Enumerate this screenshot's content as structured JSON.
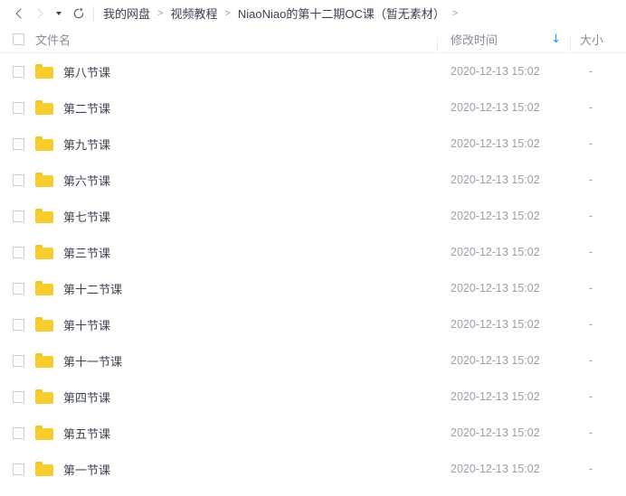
{
  "nav": {
    "back_icon": "chevron-left-icon",
    "forward_icon": "chevron-right-icon",
    "history_dropdown_icon": "caret-down-icon",
    "refresh_icon": "refresh-icon",
    "breadcrumb": {
      "items": [
        "我的网盘",
        "视频教程",
        "NiaoNiao的第十二期OC课（暂无素材）"
      ],
      "separator": ">",
      "trailing_separator": ">"
    }
  },
  "header": {
    "select_all_checkbox": "select-all-checkbox",
    "name_label": "文件名",
    "time_label": "修改时间",
    "size_label": "大小",
    "sort_arrow_glyph": "↓",
    "sort_direction": "descending",
    "sort_color": "#1e9bf7"
  },
  "colors": {
    "folder": "#f7cd2e",
    "folder_tab": "#f3c623",
    "accent": "#1e9bf7",
    "text_primary": "#3c4253",
    "text_muted": "#9aa0ab"
  },
  "files": [
    {
      "name": "第八节课",
      "modified": "2020-12-13 15:02",
      "size": "-",
      "icon": "folder-icon"
    },
    {
      "name": "第二节课",
      "modified": "2020-12-13 15:02",
      "size": "-",
      "icon": "folder-icon"
    },
    {
      "name": "第九节课",
      "modified": "2020-12-13 15:02",
      "size": "-",
      "icon": "folder-icon"
    },
    {
      "name": "第六节课",
      "modified": "2020-12-13 15:02",
      "size": "-",
      "icon": "folder-icon"
    },
    {
      "name": "第七节课",
      "modified": "2020-12-13 15:02",
      "size": "-",
      "icon": "folder-icon"
    },
    {
      "name": "第三节课",
      "modified": "2020-12-13 15:02",
      "size": "-",
      "icon": "folder-icon"
    },
    {
      "name": "第十二节课",
      "modified": "2020-12-13 15:02",
      "size": "-",
      "icon": "folder-icon"
    },
    {
      "name": "第十节课",
      "modified": "2020-12-13 15:02",
      "size": "-",
      "icon": "folder-icon"
    },
    {
      "name": "第十一节课",
      "modified": "2020-12-13 15:02",
      "size": "-",
      "icon": "folder-icon"
    },
    {
      "name": "第四节课",
      "modified": "2020-12-13 15:02",
      "size": "-",
      "icon": "folder-icon"
    },
    {
      "name": "第五节课",
      "modified": "2020-12-13 15:02",
      "size": "-",
      "icon": "folder-icon"
    },
    {
      "name": "第一节课",
      "modified": "2020-12-13 15:02",
      "size": "-",
      "icon": "folder-icon"
    }
  ]
}
